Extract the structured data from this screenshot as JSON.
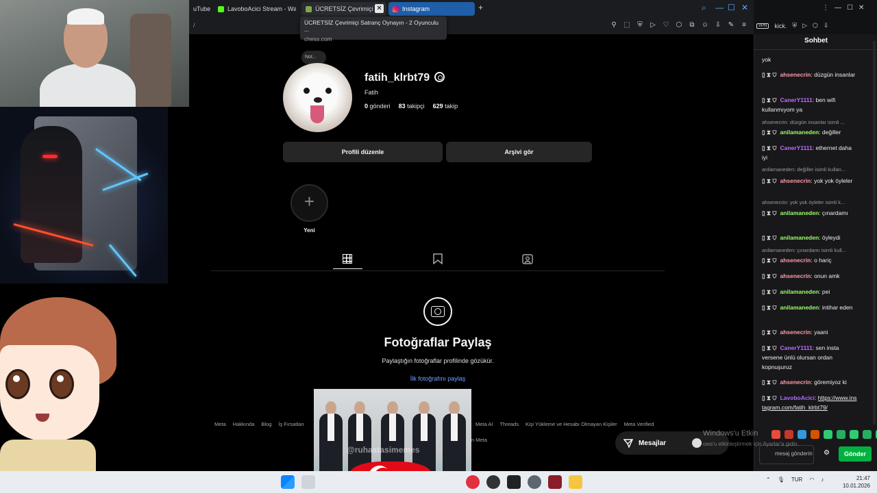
{
  "browser": {
    "tabs": [
      {
        "label": "uTube"
      },
      {
        "label": "LavoboAcici Stream - Wat"
      },
      {
        "label": "ÜCRETSİZ Çevrimiçi S"
      },
      {
        "label": "Instagram"
      }
    ],
    "address_partial": "/",
    "tooltip": {
      "title": "ÜCRETSİZ Çevrimiçi Satranç Oynayın - 2 Oyunculu ...",
      "url": "chess.com"
    }
  },
  "profile": {
    "note_label": "Not...",
    "username": "fatih_klrbt79",
    "full_name": "Fatih",
    "posts_count": "0",
    "posts_label": "gönderi",
    "followers_count": "83",
    "followers_label": "takipçi",
    "following_count": "629",
    "following_label": "takip",
    "edit_profile_label": "Profili düzenle",
    "archive_label": "Arşivi gör",
    "new_highlight_label": "Yeni"
  },
  "empty_state": {
    "title": "Fotoğraflar Paylaş",
    "subtitle": "Paylaştığın fotoğraflar profilinde gözükür.",
    "link": "İlk fotoğrafını paylaş"
  },
  "footer": {
    "left_links": [
      "Meta",
      "Hakkında",
      "Blog",
      "İş Fırsatları"
    ],
    "right_links": [
      "Meta AI",
      "Threads",
      "Kişi Yükleme ve Hesabı Olmayan Kişiler",
      "Meta Verified"
    ],
    "copyright_partial": "n Meta"
  },
  "messages_pill": {
    "label": "Mesajlar"
  },
  "windows_watermark": {
    "line1": "Windows'u Etkin",
    "line2": "ows'u etkinleştirmek için Ayarlar'a gidin."
  },
  "popup_watermark": "@ruhastasimemes",
  "chat": {
    "header": "Sohbet",
    "top_bar_text": "kick.",
    "messages": [
      {
        "type": "msg",
        "user": "",
        "text": "yok",
        "color": "#efeff1"
      },
      {
        "type": "msg",
        "user": "ahsenecrin",
        "text": "düzgün insanlar",
        "color": "#ff9ca8"
      },
      {
        "type": "msg",
        "user": "CanerY1111",
        "text": "ben wifi kullanmıyom ya",
        "color": "#c06cff"
      },
      {
        "type": "reply",
        "text": "ahsenecrin: düzgün insanlar isimli ..."
      },
      {
        "type": "msg",
        "user": "anilamaneden",
        "text": "değiller",
        "color": "#9cff6a"
      },
      {
        "type": "msg",
        "user": "CanerY1111",
        "text": "ethernet daha iyi",
        "color": "#c06cff"
      },
      {
        "type": "reply",
        "text": "anilamaneden: değiller isimli kullan..."
      },
      {
        "type": "msg",
        "user": "ahsenecrin",
        "text": "yok yok öyleler",
        "color": "#ff9ca8"
      },
      {
        "type": "reply",
        "text": "ahsenecrin: yok yok öyleler isimli k..."
      },
      {
        "type": "msg",
        "user": "anilamaneden",
        "text": "çınardamı",
        "color": "#9cff6a"
      },
      {
        "type": "msg",
        "user": "anilamaneden",
        "text": "öyleydi",
        "color": "#9cff6a"
      },
      {
        "type": "reply",
        "text": "anilamaneden: çınardamı isimli kull..."
      },
      {
        "type": "msg",
        "user": "ahsenecrin",
        "text": "o hariç",
        "color": "#ff9ca8"
      },
      {
        "type": "msg",
        "user": "ahsenecrin",
        "text": "onun amk",
        "color": "#ff9ca8"
      },
      {
        "type": "msg",
        "user": "anilamaneden",
        "text": "pei",
        "color": "#9cff6a"
      },
      {
        "type": "msg",
        "user": "anilamaneden",
        "text": "intihar eden",
        "color": "#9cff6a"
      },
      {
        "type": "msg",
        "user": "ahsenecrin",
        "text": "yaani",
        "color": "#ff9ca8"
      },
      {
        "type": "msg",
        "user": "CanerY1111",
        "text": "sen insta versene ünlü olursan ordan kopnuşuruz",
        "color": "#c06cff"
      },
      {
        "type": "msg",
        "user": "ahsenecrin",
        "text": "göremiyoz ki",
        "color": "#ff9ca8"
      },
      {
        "type": "msg",
        "user": "LavoboAcici",
        "text": "https://www.instagram.com/fatih_klrbt79/",
        "color": "#b06cff"
      }
    ],
    "input_placeholder": "mesaj gönderin",
    "send_label": "Gönder"
  },
  "taskbar": {
    "language": "TUR",
    "time": "21:47",
    "date": "10.01.2026"
  },
  "colors": {
    "instagram_bg": "#000000",
    "button_bg": "#262626",
    "link_blue": "#6ea4ff",
    "kick_green": "#00b140"
  }
}
